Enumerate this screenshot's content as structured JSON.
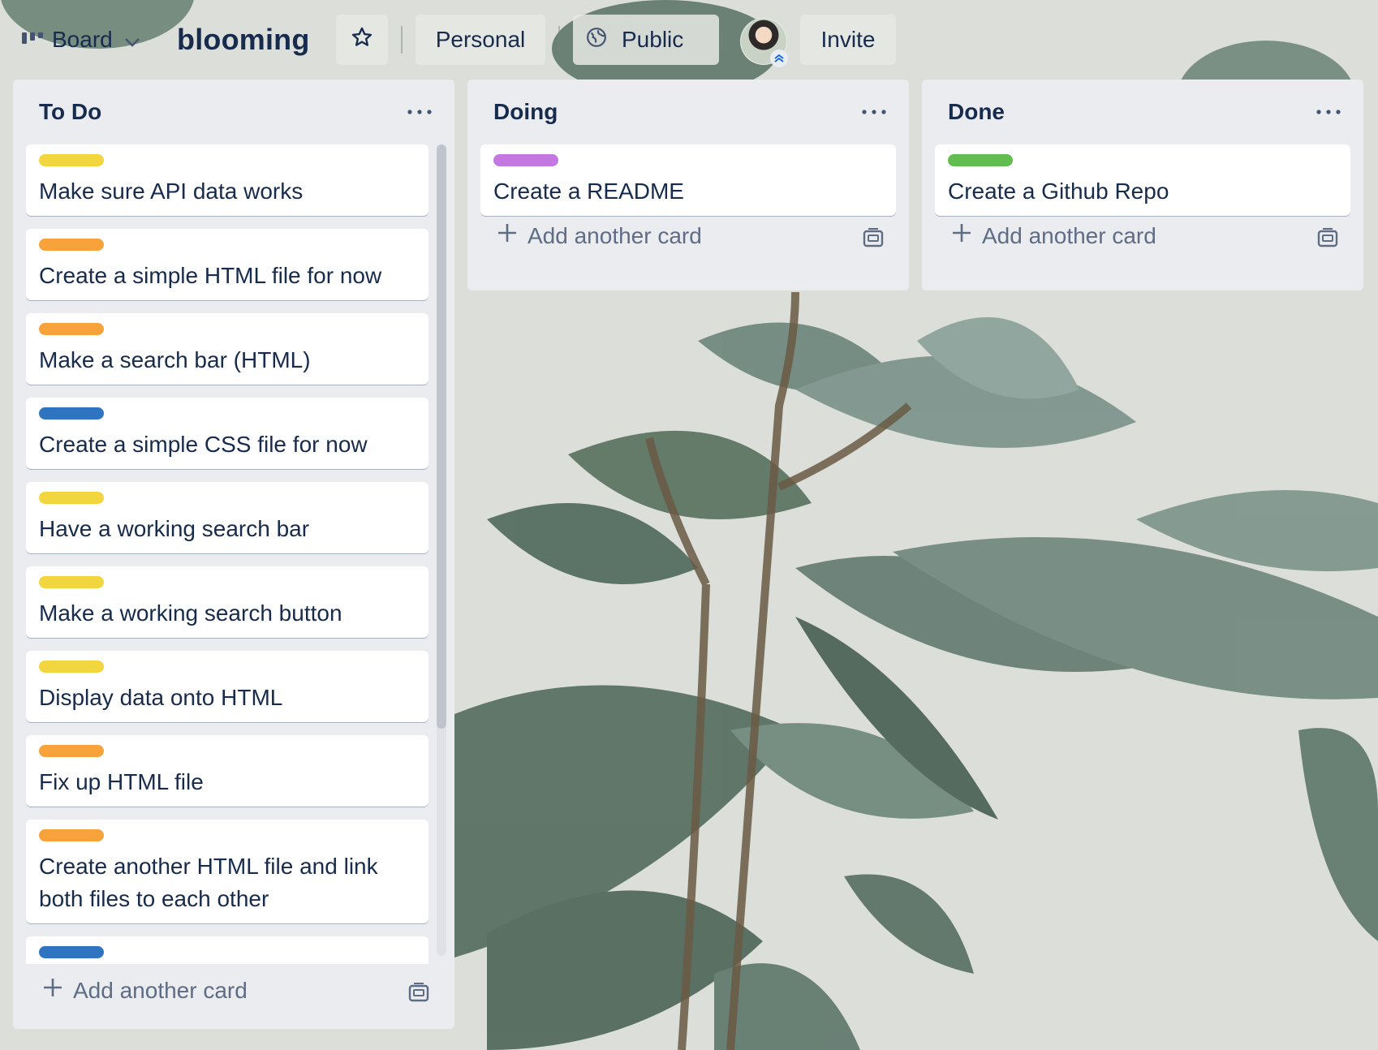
{
  "header": {
    "view_label": "Board",
    "board_title": "blooming",
    "workspace_label": "Personal",
    "visibility_label": "Public",
    "invite_label": "Invite"
  },
  "lists": [
    {
      "title": "To Do",
      "add_label": "Add another card",
      "cards": [
        {
          "label_color": "#f2d640",
          "text": "Make sure API data works"
        },
        {
          "label_color": "#f7a23b",
          "text": "Create a simple HTML file for now"
        },
        {
          "label_color": "#f7a23b",
          "text": "Make a search bar (HTML)"
        },
        {
          "label_color": "#2f74c0",
          "text": "Create a simple CSS file for now"
        },
        {
          "label_color": "#f2d640",
          "text": "Have a working search bar"
        },
        {
          "label_color": "#f2d640",
          "text": "Make a working search button"
        },
        {
          "label_color": "#f2d640",
          "text": "Display data onto HTML"
        },
        {
          "label_color": "#f7a23b",
          "text": "Fix up HTML file"
        },
        {
          "label_color": "#f7a23b",
          "text": "Create another HTML file and link both files to each other"
        },
        {
          "label_color": "#2f74c0",
          "text": ""
        }
      ]
    },
    {
      "title": "Doing",
      "add_label": "Add another card",
      "cards": [
        {
          "label_color": "#c377e0",
          "text": "Create a README"
        }
      ]
    },
    {
      "title": "Done",
      "add_label": "Add another card",
      "cards": [
        {
          "label_color": "#61bd4f",
          "text": "Create a Github Repo"
        }
      ]
    }
  ],
  "icons": {
    "view": "board-columns-icon",
    "star": "star-icon",
    "visibility": "globe-icon",
    "list_menu": "ellipsis-icon",
    "add": "plus-icon",
    "template": "card-template-icon"
  }
}
